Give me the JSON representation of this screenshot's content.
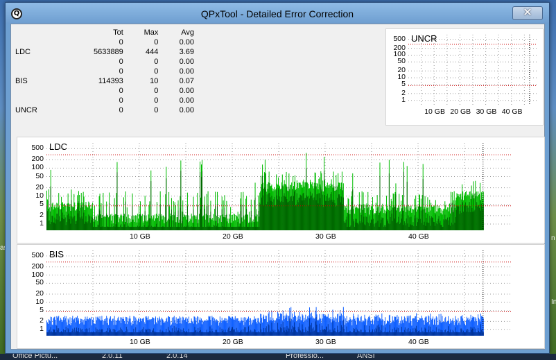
{
  "window": {
    "title": "QPxTool - Detailed Error Correction",
    "close_glyph": "✕",
    "app_icon_glyph": "Q"
  },
  "stats": {
    "headers": [
      "",
      "Tot",
      "Max",
      "Avg"
    ],
    "rows": [
      {
        "label": "",
        "tot": "0",
        "max": "0",
        "avg": "0.00"
      },
      {
        "label": "LDC",
        "tot": "5633889",
        "max": "444",
        "avg": "3.69"
      },
      {
        "label": "",
        "tot": "0",
        "max": "0",
        "avg": "0.00"
      },
      {
        "label": "",
        "tot": "0",
        "max": "0",
        "avg": "0.00"
      },
      {
        "label": "BIS",
        "tot": "114393",
        "max": "10",
        "avg": "0.07"
      },
      {
        "label": "",
        "tot": "0",
        "max": "0",
        "avg": "0.00"
      },
      {
        "label": "",
        "tot": "0",
        "max": "0",
        "avg": "0.00"
      },
      {
        "label": "UNCR",
        "tot": "0",
        "max": "0",
        "avg": "0.00"
      }
    ]
  },
  "chart_data": [
    {
      "type": "bar",
      "title": "UNCR",
      "yscale": "log",
      "yticks": [
        "500",
        "200",
        "100",
        "50",
        "20",
        "10",
        "5",
        "2",
        "1"
      ],
      "ytick_values": [
        500,
        200,
        100,
        50,
        20,
        10,
        5,
        2,
        1
      ],
      "xticks": [
        "10 GB",
        "20 GB",
        "30 GB",
        "40 GB"
      ],
      "xtick_values": [
        10,
        20,
        30,
        40
      ],
      "xlim": [
        0,
        50
      ],
      "grid": true,
      "series": [
        {
          "color": "#0000ff",
          "values": []
        }
      ],
      "threshold_lines": [
        300,
        4.5
      ],
      "end_marker": 47,
      "colors": {
        "threshold": "#cc0000"
      }
    },
    {
      "type": "bar",
      "title": "LDC",
      "yscale": "log",
      "yticks": [
        "500",
        "200",
        "100",
        "50",
        "20",
        "10",
        "5",
        "2",
        "1"
      ],
      "ytick_values": [
        500,
        200,
        100,
        50,
        20,
        10,
        5,
        2,
        1
      ],
      "xticks": [
        "10 GB",
        "20 GB",
        "30 GB",
        "40 GB"
      ],
      "xtick_values": [
        10,
        20,
        30,
        40
      ],
      "xlim": [
        0,
        50
      ],
      "max_x": 47,
      "grid": true,
      "threshold_lines": [
        300,
        4.5
      ],
      "end_marker": 47,
      "segments": [
        {
          "from": 0,
          "to": 5,
          "peak": 20,
          "base": 4,
          "spike": 200
        },
        {
          "from": 5,
          "to": 23,
          "peak": 15,
          "base": 1.5,
          "spike": 200
        },
        {
          "from": 23,
          "to": 32,
          "peak": 80,
          "base": 20,
          "spike": 400
        },
        {
          "from": 32,
          "to": 44,
          "peak": 15,
          "base": 3,
          "spike": 250
        },
        {
          "from": 44,
          "to": 47,
          "peak": 40,
          "base": 10,
          "spike": 200
        }
      ],
      "colors": {
        "bar": "#00bb00",
        "dark": "#006600",
        "threshold": "#cc0000"
      }
    },
    {
      "type": "bar",
      "title": "BIS",
      "yscale": "log",
      "yticks": [
        "500",
        "200",
        "100",
        "50",
        "20",
        "10",
        "5",
        "2",
        "1"
      ],
      "ytick_values": [
        500,
        200,
        100,
        50,
        20,
        10,
        5,
        2,
        1
      ],
      "xticks": [
        "10 GB",
        "20 GB",
        "30 GB",
        "40 GB"
      ],
      "xtick_values": [
        10,
        20,
        30,
        40
      ],
      "xlim": [
        0,
        50
      ],
      "max_x": 47,
      "grid": true,
      "threshold_lines": [
        300,
        4.5
      ],
      "end_marker": 47,
      "segments": [
        {
          "from": 0,
          "to": 23,
          "peak": 3,
          "base": 2
        },
        {
          "from": 23,
          "to": 32,
          "peak": 7,
          "base": 2.5
        },
        {
          "from": 32,
          "to": 47,
          "peak": 4,
          "base": 2
        }
      ],
      "colors": {
        "bar": "#1060ff",
        "dark": "#003399",
        "threshold": "#cc0000"
      }
    }
  ],
  "taskbar": {
    "items": [
      "Office Pictu...",
      "2.0.11",
      "2.0.14",
      "Professio...",
      "ANSI"
    ]
  },
  "desktop": {
    "left_edge_text": "as",
    "right_edge_text_1": "n",
    "right_edge_text_2": "In"
  }
}
